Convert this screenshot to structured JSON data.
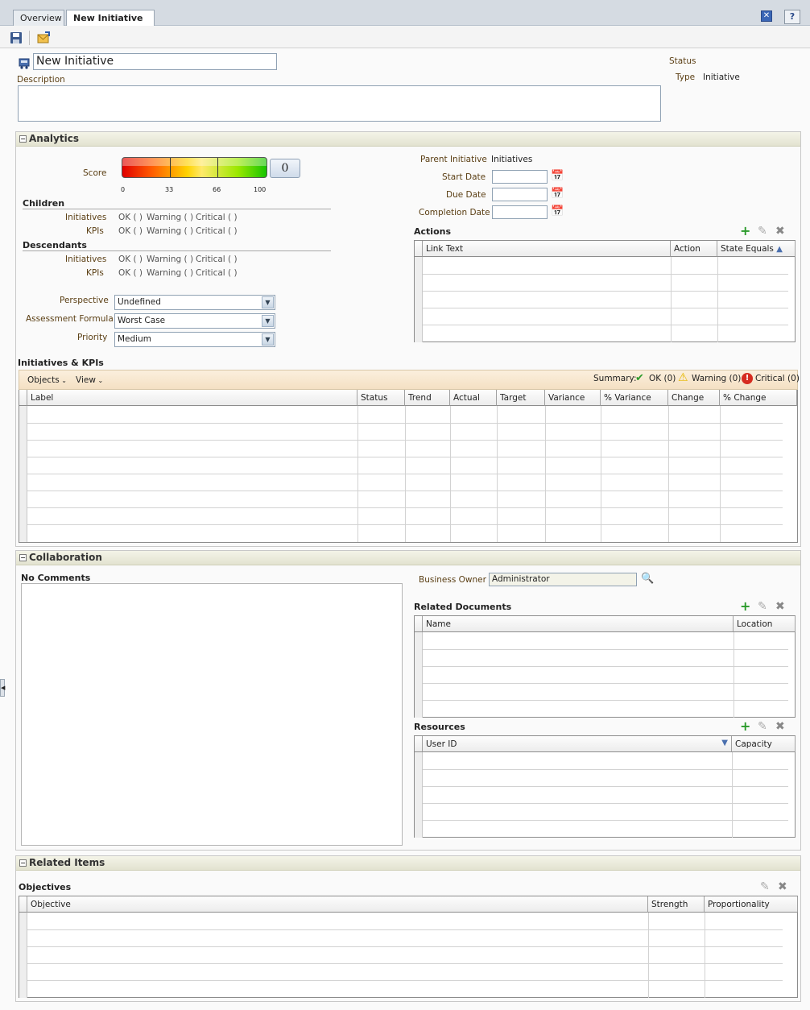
{
  "tabs": [
    {
      "label": "Overview"
    },
    {
      "label": "New Initiative"
    }
  ],
  "header": {
    "title": "New Initiative",
    "description_label": "Description",
    "status_label": "Status",
    "type_label": "Type",
    "type_value": "Initiative"
  },
  "analytics": {
    "title": "Analytics",
    "score_label": "Score",
    "score_value": "0",
    "gauge_ticks": [
      "0",
      "33",
      "66",
      "100"
    ],
    "children_title": "Children",
    "descendants_title": "Descendants",
    "rows": [
      {
        "label": "Initiatives",
        "ok": "OK ( )",
        "warning": "Warning ( )",
        "critical": "Critical ( )"
      },
      {
        "label": "KPIs",
        "ok": "OK ( )",
        "warning": "Warning ( )",
        "critical": "Critical ( )"
      }
    ],
    "perspective_label": "Perspective",
    "perspective_value": "Undefined",
    "assessment_label": "Assessment Formula",
    "assessment_value": "Worst Case",
    "priority_label": "Priority",
    "priority_value": "Medium",
    "parent_label": "Parent Initiative",
    "parent_value": "Initiatives",
    "start_label": "Start Date",
    "due_label": "Due Date",
    "completion_label": "Completion Date",
    "actions_title": "Actions",
    "actions_columns": [
      "Link Text",
      "Action",
      "State Equals"
    ]
  },
  "kpis": {
    "title": "Initiatives & KPIs",
    "objects_menu": "Objects",
    "view_menu": "View",
    "summary_label": "Summary:",
    "ok_label": "OK (0)",
    "warning_label": "Warning (0)",
    "critical_label": "Critical (0)",
    "columns": [
      "Label",
      "Status",
      "Trend",
      "Actual",
      "Target",
      "Variance",
      "% Variance",
      "Change",
      "% Change"
    ]
  },
  "collaboration": {
    "title": "Collaboration",
    "no_comments": "No Comments",
    "business_owner_label": "Business Owner",
    "business_owner_value": "Administrator",
    "related_docs_title": "Related Documents",
    "docs_columns": [
      "Name",
      "Location"
    ],
    "resources_title": "Resources",
    "resources_columns": [
      "User ID",
      "Capacity"
    ]
  },
  "related": {
    "title": "Related Items",
    "objectives_title": "Objectives",
    "columns": [
      "Objective",
      "Strength",
      "Proportionality"
    ]
  },
  "colors": {
    "label": "#5a3e13",
    "ok": "#2a9a2a",
    "warning": "#e6b800",
    "critical": "#d62b1f"
  }
}
